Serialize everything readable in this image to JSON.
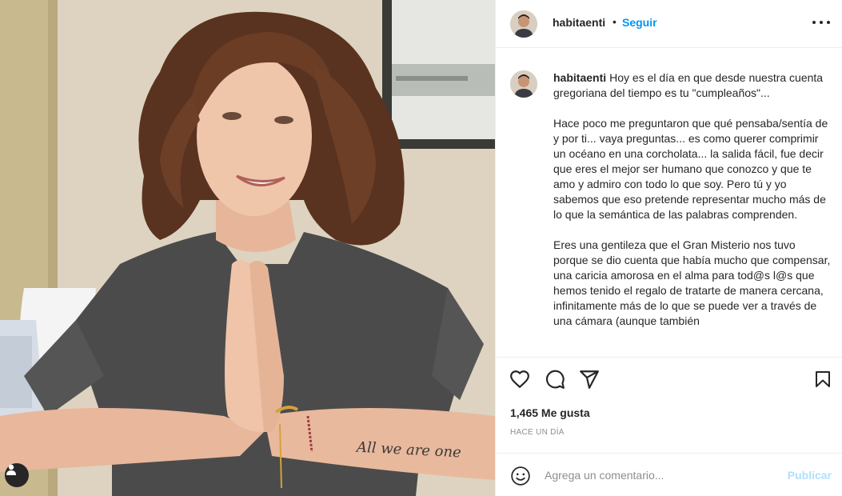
{
  "post": {
    "username": "habitaenti",
    "follow_label": "Seguir",
    "separator": "•",
    "caption_paragraphs": [
      "Hoy es el día en que desde nuestra cuenta gregoriana del tiempo es tu \"cumpleaños\"...",
      "Hace poco me preguntaron que qué pensaba/sentía de y por ti... vaya preguntas... es como querer comprimir un océano en una corcholata... la salida fácil, fue decir que eres el mejor ser humano que conozco y que te amo y admiro con todo lo que soy. Pero tú y yo sabemos que eso pretende representar mucho más de lo que la semántica de las palabras comprenden.",
      "Eres una gentileza que el Gran Misterio nos tuvo porque se dio cuenta que había mucho que compensar, una caricia amorosa en el alma para tod@s l@s que hemos tenido el regalo de tratarte de manera cercana, infinitamente más de lo que se puede ver a través de una cámara (aunque también"
    ],
    "likes_text": "1,465 Me gusta",
    "time_text": "HACE UN DÍA",
    "tattoo_text": "All we are one"
  },
  "comment": {
    "placeholder": "Agrega un comentario...",
    "publish_label": "Publicar"
  },
  "icons": {
    "more": "more-options-icon",
    "like": "heart-icon",
    "comment": "comment-icon",
    "share": "share-icon",
    "save": "bookmark-icon",
    "emoji": "emoji-icon",
    "tag": "user-tag-icon"
  },
  "colors": {
    "link_blue": "#0095f6",
    "publish_disabled": "#b2dffc",
    "text": "#262626",
    "muted": "#8e8e8e",
    "border": "#efefef"
  }
}
